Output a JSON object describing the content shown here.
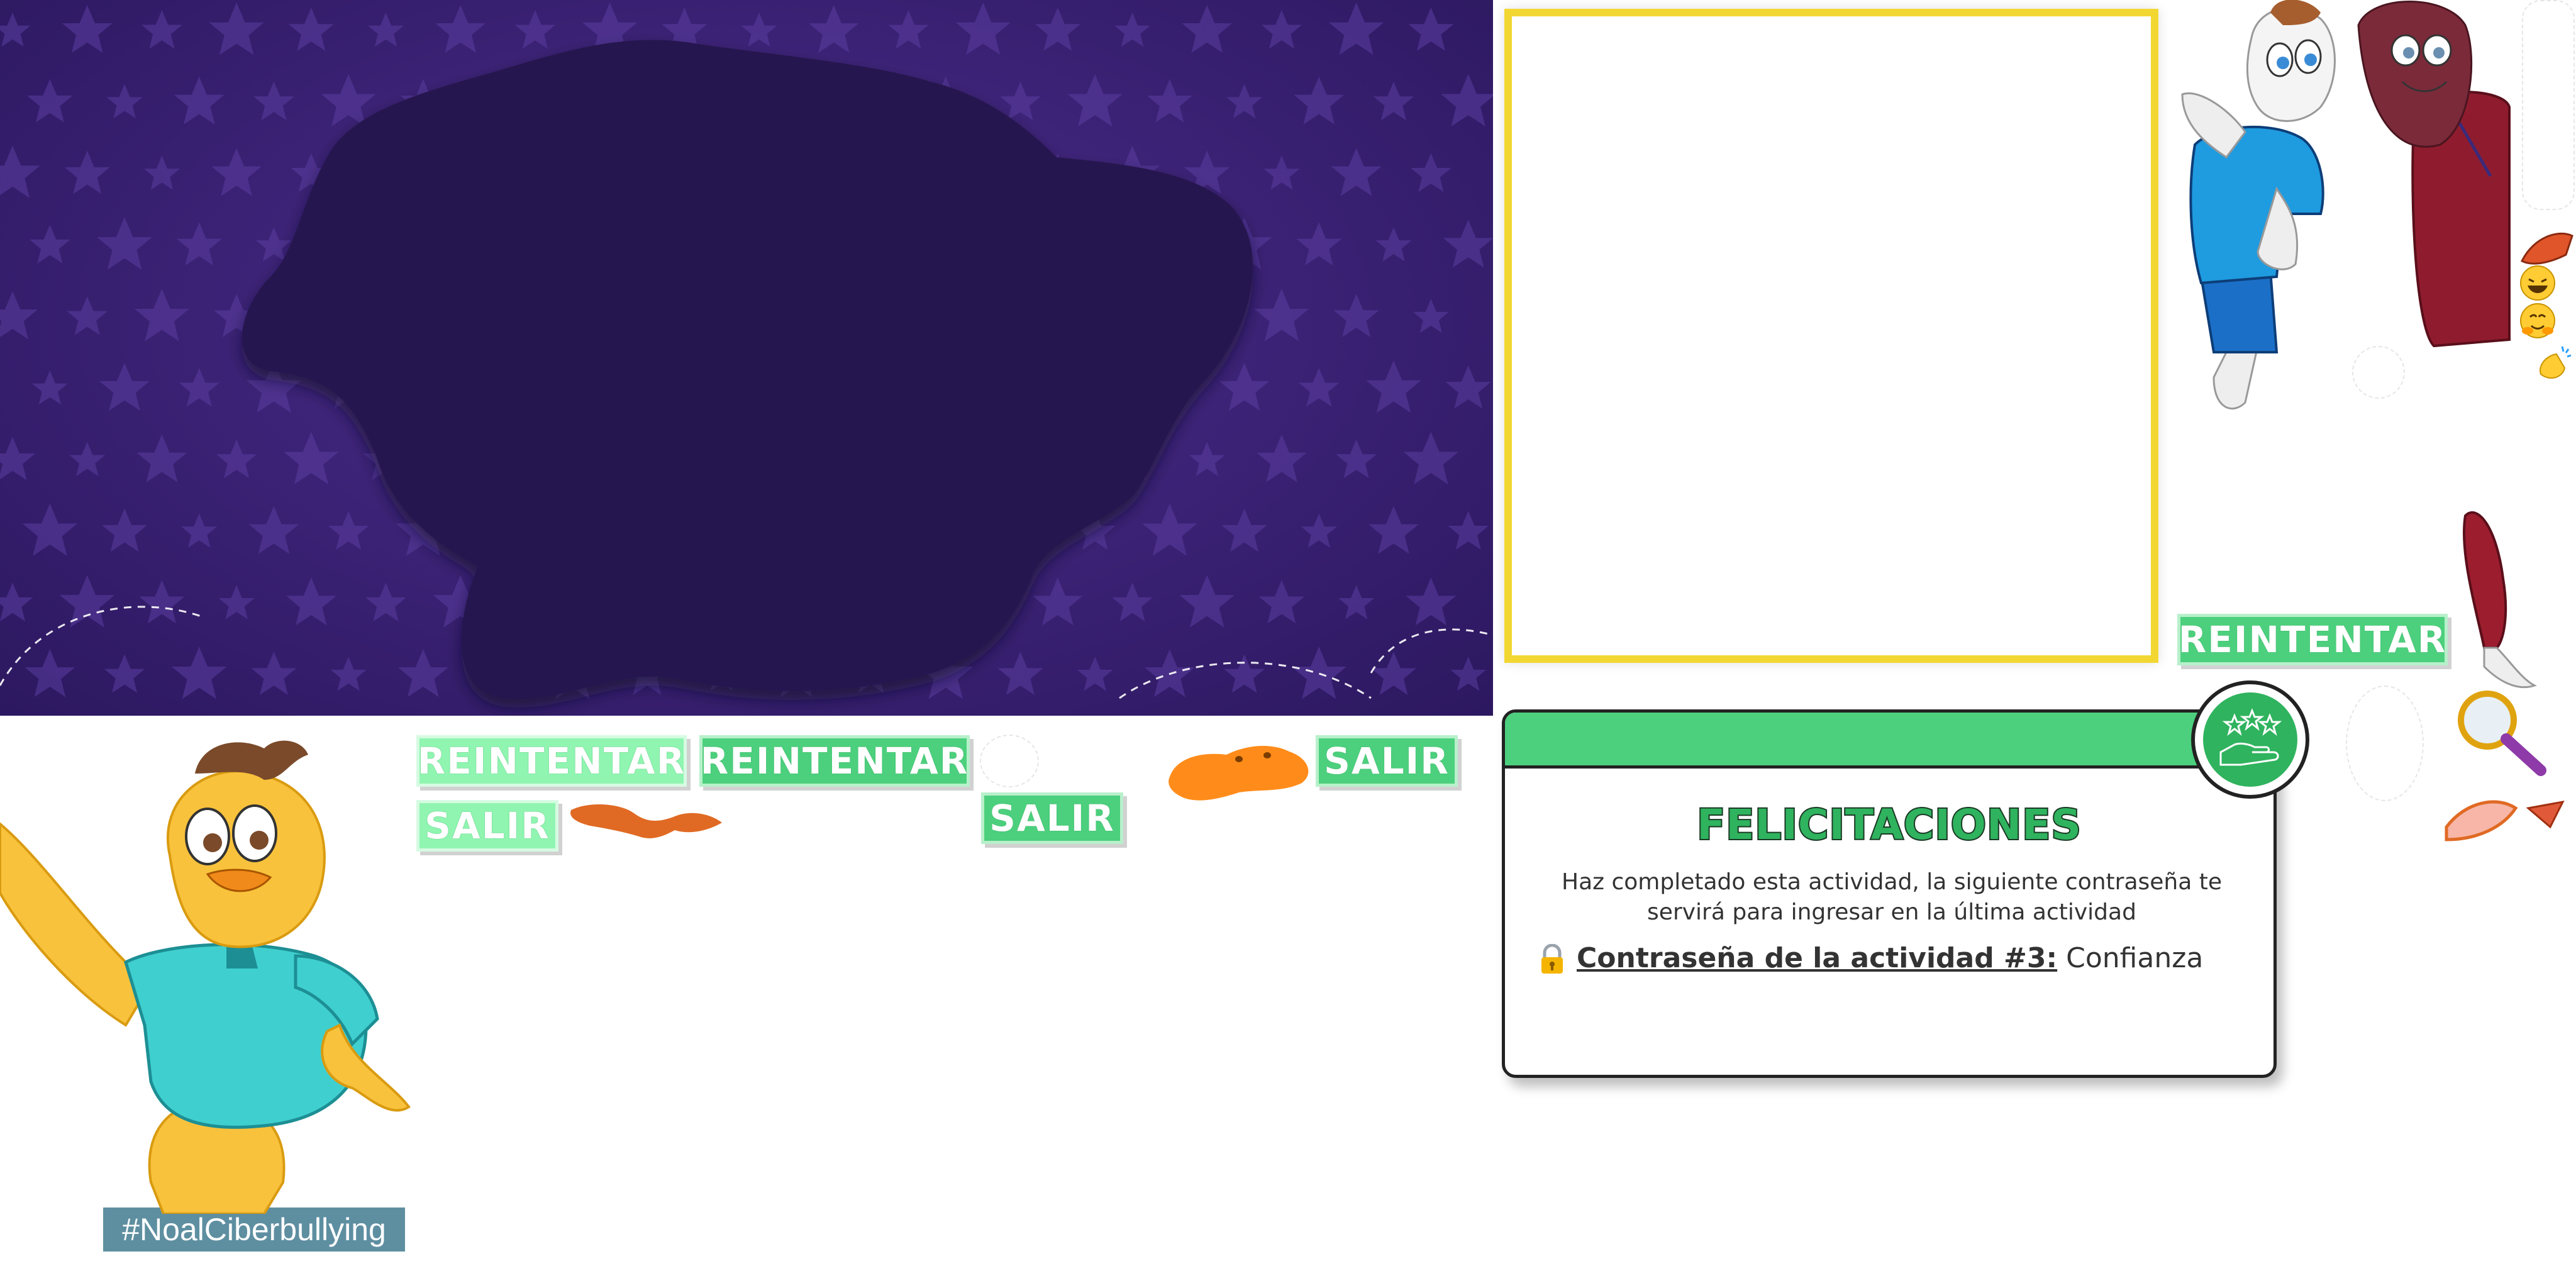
{
  "buttons": {
    "retry_1": "REINTENTAR",
    "retry_2": "REINTENTAR",
    "retry_3": "REINTENTAR",
    "exit_1": "SALIR",
    "exit_2": "SALIR",
    "exit_3": "SALIR"
  },
  "congrats": {
    "title": "FELICITACIONES",
    "body": "Haz completado esta actividad, la siguiente contraseña te servirá para ingresar en la última actividad",
    "password_label": "Contraseña de la actividad #3:",
    "password_value": "Confianza",
    "lock_icon": "lock-key-icon",
    "badge_icon": "hand-stars-icon"
  },
  "hashtag": "#NoalCiberbullying",
  "colors": {
    "background_purple": "#3a2173",
    "blob_purple": "#271650",
    "button_green": "#4cd07d",
    "button_light_green": "#8ff5b0",
    "frame_yellow": "#f2d733",
    "card_header_green": "#4cd07d",
    "hashtag_bg": "#5e8fa1"
  },
  "icons": [
    "magnifier-icon",
    "laughing-emoji-icon",
    "hug-emoji-icon",
    "clapping-hands-icon",
    "paint-brush-icon",
    "speech-bubble-icon",
    "chick-mascot",
    "boy-character",
    "girl-character"
  ]
}
